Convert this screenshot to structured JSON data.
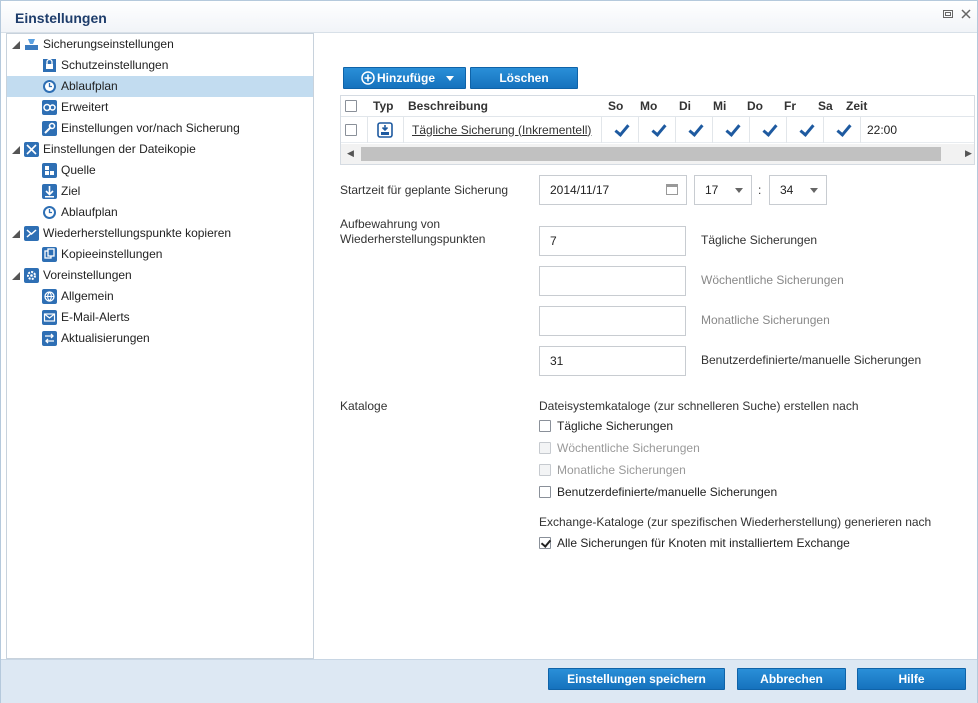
{
  "window": {
    "title": "Einstellungen"
  },
  "tree": {
    "items": [
      {
        "label": "Sicherungseinstellungen",
        "level": 0,
        "icon": "backup-settings-icon",
        "expandable": true
      },
      {
        "label": "Schutzeinstellungen",
        "level": 1,
        "icon": "protection-icon"
      },
      {
        "label": "Ablaufplan",
        "level": 1,
        "icon": "schedule-icon",
        "selected": true
      },
      {
        "label": "Erweitert",
        "level": 1,
        "icon": "advanced-icon"
      },
      {
        "label": "Einstellungen vor/nach Sicherung",
        "level": 1,
        "icon": "wrench-icon"
      },
      {
        "label": "Einstellungen der Dateikopie",
        "level": 0,
        "icon": "file-copy-icon",
        "expandable": true
      },
      {
        "label": "Quelle",
        "level": 1,
        "icon": "source-icon"
      },
      {
        "label": "Ziel",
        "level": 1,
        "icon": "destination-icon"
      },
      {
        "label": "Ablaufplan",
        "level": 1,
        "icon": "schedule-icon"
      },
      {
        "label": "Wiederherstellungspunkte kopieren",
        "level": 0,
        "icon": "copy-recovery-points-icon",
        "expandable": true
      },
      {
        "label": "Kopieeinstellungen",
        "level": 1,
        "icon": "copy-settings-icon"
      },
      {
        "label": "Voreinstellungen",
        "level": 0,
        "icon": "preferences-icon",
        "expandable": true
      },
      {
        "label": "Allgemein",
        "level": 1,
        "icon": "general-icon"
      },
      {
        "label": "E-Mail-Alerts",
        "level": 1,
        "icon": "email-icon"
      },
      {
        "label": "Aktualisierungen",
        "level": 1,
        "icon": "updates-icon"
      }
    ]
  },
  "toolbar": {
    "add_label": "Hinzufüge",
    "delete_label": "Löschen"
  },
  "schedule_table": {
    "headers": {
      "type": "Typ",
      "description": "Beschreibung",
      "days": [
        "So",
        "Mo",
        "Di",
        "Mi",
        "Do",
        "Fr",
        "Sa"
      ],
      "time": "Zeit"
    },
    "rows": [
      {
        "description": "Tägliche Sicherung (Inkrementell)",
        "days": [
          true,
          true,
          true,
          true,
          true,
          true,
          true
        ],
        "time": "22:00"
      }
    ]
  },
  "start_time": {
    "label": "Startzeit für geplante Sicherung",
    "date": "2014/11/17",
    "hour": "17",
    "separator": ":",
    "minute": "34"
  },
  "retention": {
    "label": "Aufbewahrung von Wiederherstellungspunkten",
    "daily": {
      "value": "7",
      "label": "Tägliche Sicherungen"
    },
    "weekly": {
      "value": "",
      "label": "Wöchentliche Sicherungen"
    },
    "monthly": {
      "value": "",
      "label": "Monatliche Sicherungen"
    },
    "custom": {
      "value": "31",
      "label": "Benutzerdefinierte/manuelle Sicherungen"
    }
  },
  "catalogs": {
    "label": "Kataloge",
    "fs_heading": "Dateisystemkataloge (zur schnelleren Suche) erstellen nach",
    "fs_options": [
      {
        "label": "Tägliche Sicherungen",
        "checked": false,
        "disabled": false
      },
      {
        "label": "Wöchentliche Sicherungen",
        "checked": false,
        "disabled": true
      },
      {
        "label": "Monatliche Sicherungen",
        "checked": false,
        "disabled": true
      },
      {
        "label": "Benutzerdefinierte/manuelle Sicherungen",
        "checked": false,
        "disabled": false
      }
    ],
    "exchange_heading": "Exchange-Kataloge (zur spezifischen Wiederherstellung) generieren nach",
    "exchange_option": {
      "label": "Alle Sicherungen für Knoten mit installiertem Exchange",
      "checked": true
    }
  },
  "footer": {
    "save_label": "Einstellungen speichern",
    "cancel_label": "Abbrechen",
    "help_label": "Hilfe"
  },
  "colors": {
    "accent": "#1672bd",
    "selected_row": "#c2dcf0",
    "footer_bg": "#dde8f3",
    "title": "#1e3d6b"
  }
}
